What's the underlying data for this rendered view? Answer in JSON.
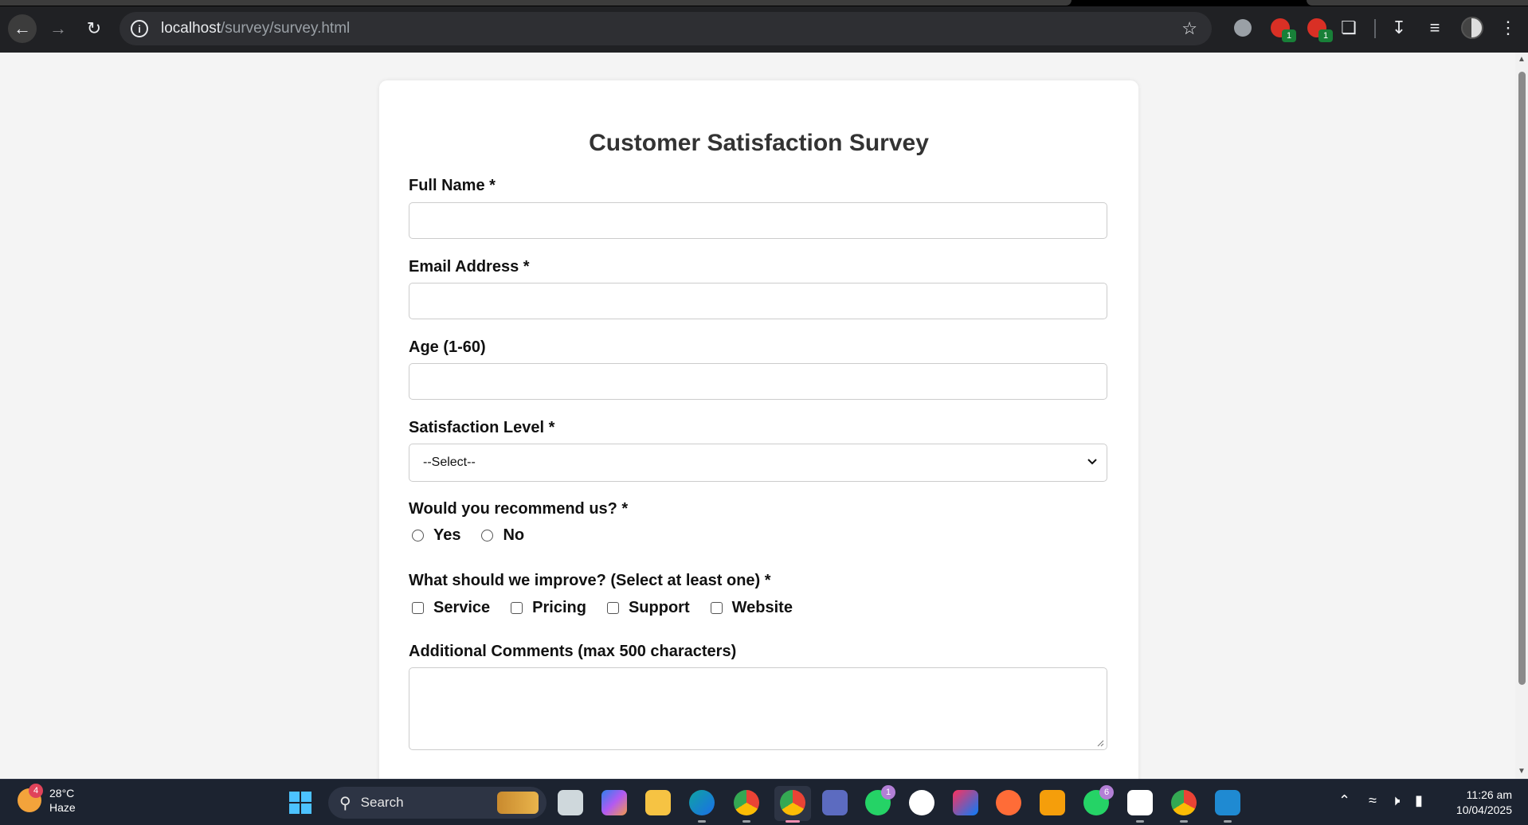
{
  "browser": {
    "url_host": "localhost",
    "url_path": "/survey/survey.html",
    "extension_badge_1": "1",
    "extension_badge_2": "1"
  },
  "form": {
    "title": "Customer Satisfaction Survey",
    "full_name_label": "Full Name *",
    "full_name_value": "",
    "email_label": "Email Address *",
    "email_value": "",
    "age_label": "Age (1-60)",
    "age_value": "",
    "satisfaction_label": "Satisfaction Level *",
    "satisfaction_selected": "--Select--",
    "recommend_label": "Would you recommend us? *",
    "recommend_options": [
      "Yes",
      "No"
    ],
    "improve_label": "What should we improve? (Select at least one) *",
    "improve_options": [
      "Service",
      "Pricing",
      "Support",
      "Website"
    ],
    "comments_label": "Additional Comments (max 500 characters)",
    "comments_value": ""
  },
  "taskbar": {
    "weather_temp": "28°C",
    "weather_desc": "Haze",
    "weather_badge": "4",
    "search_placeholder": "Search",
    "app_badge_1": "1",
    "app_badge_2": "6",
    "time": "11:26 am",
    "date": "10/04/2025"
  },
  "colors": {
    "submit_green": "#28a745",
    "chrome_dark": "#202124",
    "taskbar_bg": "#1c2330"
  }
}
